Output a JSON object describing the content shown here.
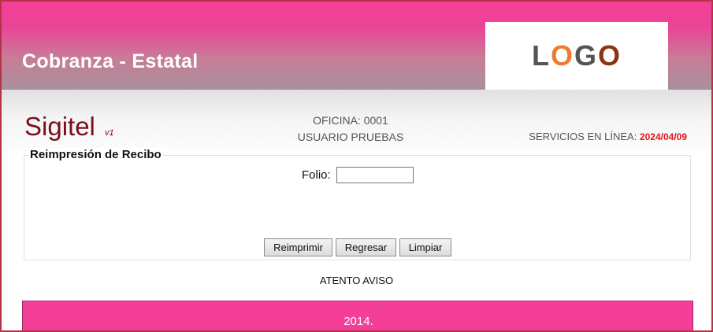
{
  "header": {
    "title": "Cobranza - Estatal",
    "logo": {
      "prefix": "L",
      "o1": "O",
      "g": "G",
      "o2": "O"
    }
  },
  "subheader": {
    "brand": "Sigitel",
    "version": "v1",
    "office": "OFICINA: 0001",
    "user": "USUARIO PRUEBAS",
    "services_label": "SERVICIOS EN LÍNEA:",
    "services_date": "2024/04/09"
  },
  "form": {
    "legend": "Reimpresión de Recibo",
    "folio_label": "Folio:",
    "folio_value": "",
    "buttons": {
      "reprint": "Reimprimir",
      "back": "Regresar",
      "clear": "Limpiar"
    }
  },
  "notice": "ATENTO AVISO",
  "footer": {
    "text": "2014."
  },
  "colors": {
    "banner_pink": "#f43f98",
    "brand_red": "#7a0f1a",
    "date_red": "#e8121a",
    "footer_pink": "#f33f98"
  }
}
